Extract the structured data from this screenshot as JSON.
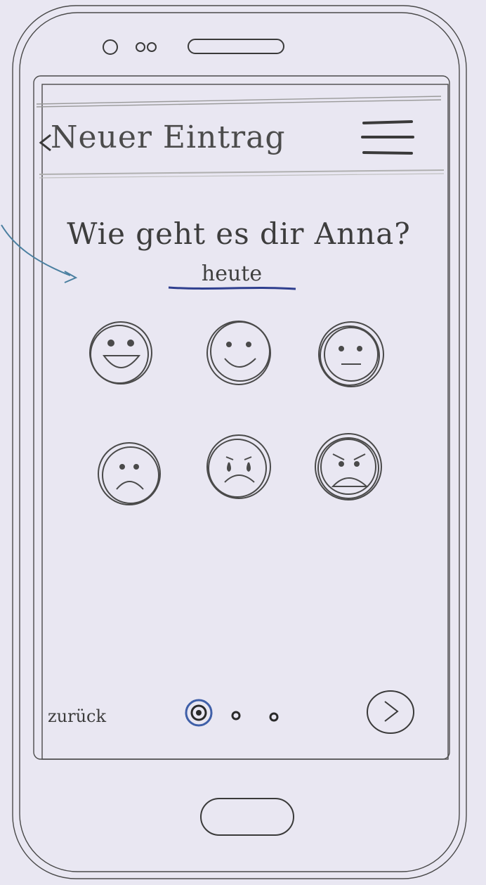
{
  "header": {
    "title": "Neuer Eintrag",
    "back_icon": "chevron-left-icon",
    "menu_icon": "hamburger-menu-icon"
  },
  "question": {
    "line1": "Wie geht es dir Anna?",
    "line2": "heute"
  },
  "moods": [
    {
      "name": "very-happy-face-icon"
    },
    {
      "name": "happy-face-icon"
    },
    {
      "name": "neutral-face-icon"
    },
    {
      "name": "sad-face-icon"
    },
    {
      "name": "crying-face-icon"
    },
    {
      "name": "angry-face-icon"
    }
  ],
  "footer": {
    "back_label": "zurück",
    "page_indicator": {
      "current": 1,
      "total": 3
    },
    "next_icon": "chevron-right-circle-icon"
  },
  "colors": {
    "background": "#e9e7f2",
    "pencil": "#4a4a4a",
    "ink_blue": "#2f3f8f",
    "active_dot": "#3f5fa8"
  }
}
